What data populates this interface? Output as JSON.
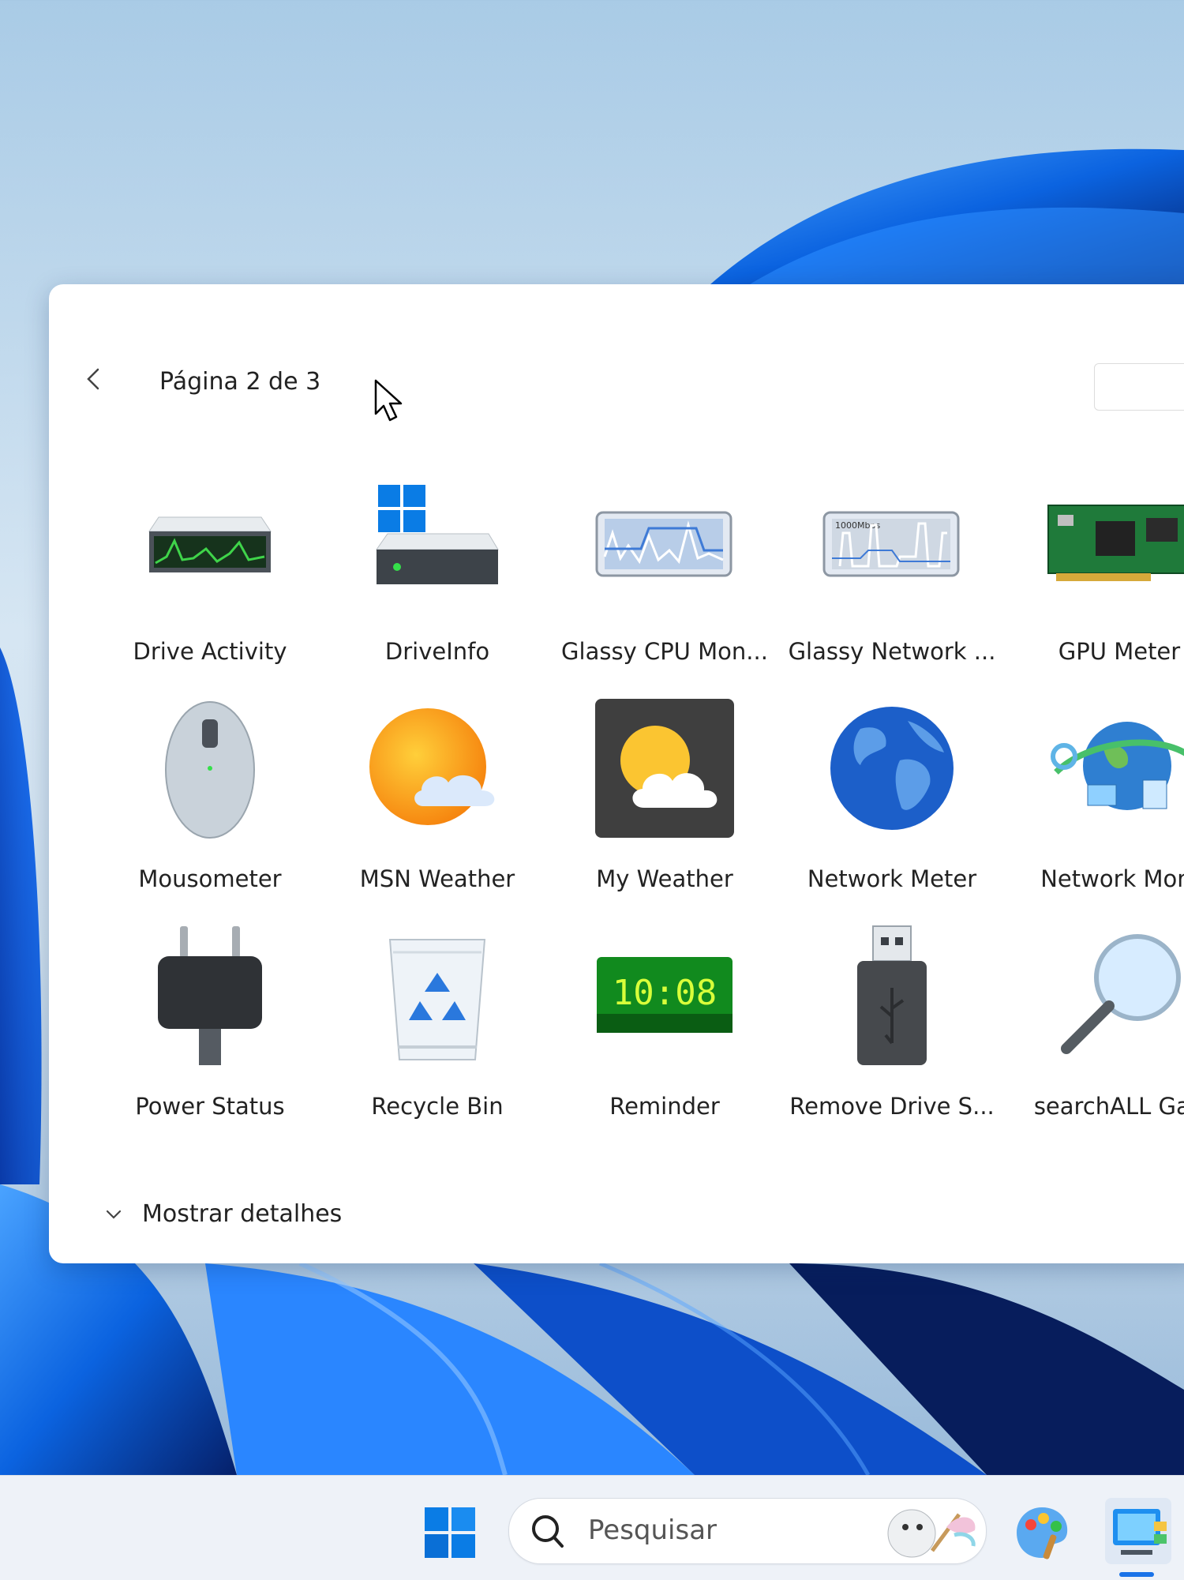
{
  "gallery": {
    "page_label": "Página 2 de 3",
    "show_details": "Mostrar detalhes",
    "gadgets": [
      {
        "label": "Drive Activity",
        "icon": "drive-activity-icon"
      },
      {
        "label": "DriveInfo",
        "icon": "drive-info-icon"
      },
      {
        "label": "Glassy CPU Mon...",
        "icon": "cpu-monitor-icon"
      },
      {
        "label": "Glassy Network ...",
        "icon": "network-graph-icon"
      },
      {
        "label": "GPU Meter",
        "icon": "gpu-card-icon"
      },
      {
        "label": "Mousometer",
        "icon": "mouse-icon"
      },
      {
        "label": "MSN Weather",
        "icon": "sun-cloud-icon"
      },
      {
        "label": "My Weather",
        "icon": "weather-tile-icon"
      },
      {
        "label": "Network Meter",
        "icon": "globe-icon"
      },
      {
        "label": "Network Moni",
        "icon": "network-globe-icon"
      },
      {
        "label": "Power Status",
        "icon": "power-plug-icon"
      },
      {
        "label": "Recycle Bin",
        "icon": "recycle-bin-icon"
      },
      {
        "label": "Reminder",
        "icon": "digital-clock-icon"
      },
      {
        "label": "Remove Drive S...",
        "icon": "usb-drive-icon"
      },
      {
        "label": "searchALL Gad",
        "icon": "magnifier-icon"
      }
    ],
    "clock_text": "10:08",
    "graph_badge": "1000Mbps"
  },
  "taskbar": {
    "search_placeholder": "Pesquisar"
  },
  "colors": {
    "accent": "#1a73e8",
    "win_blue": "#0a7ce5"
  }
}
